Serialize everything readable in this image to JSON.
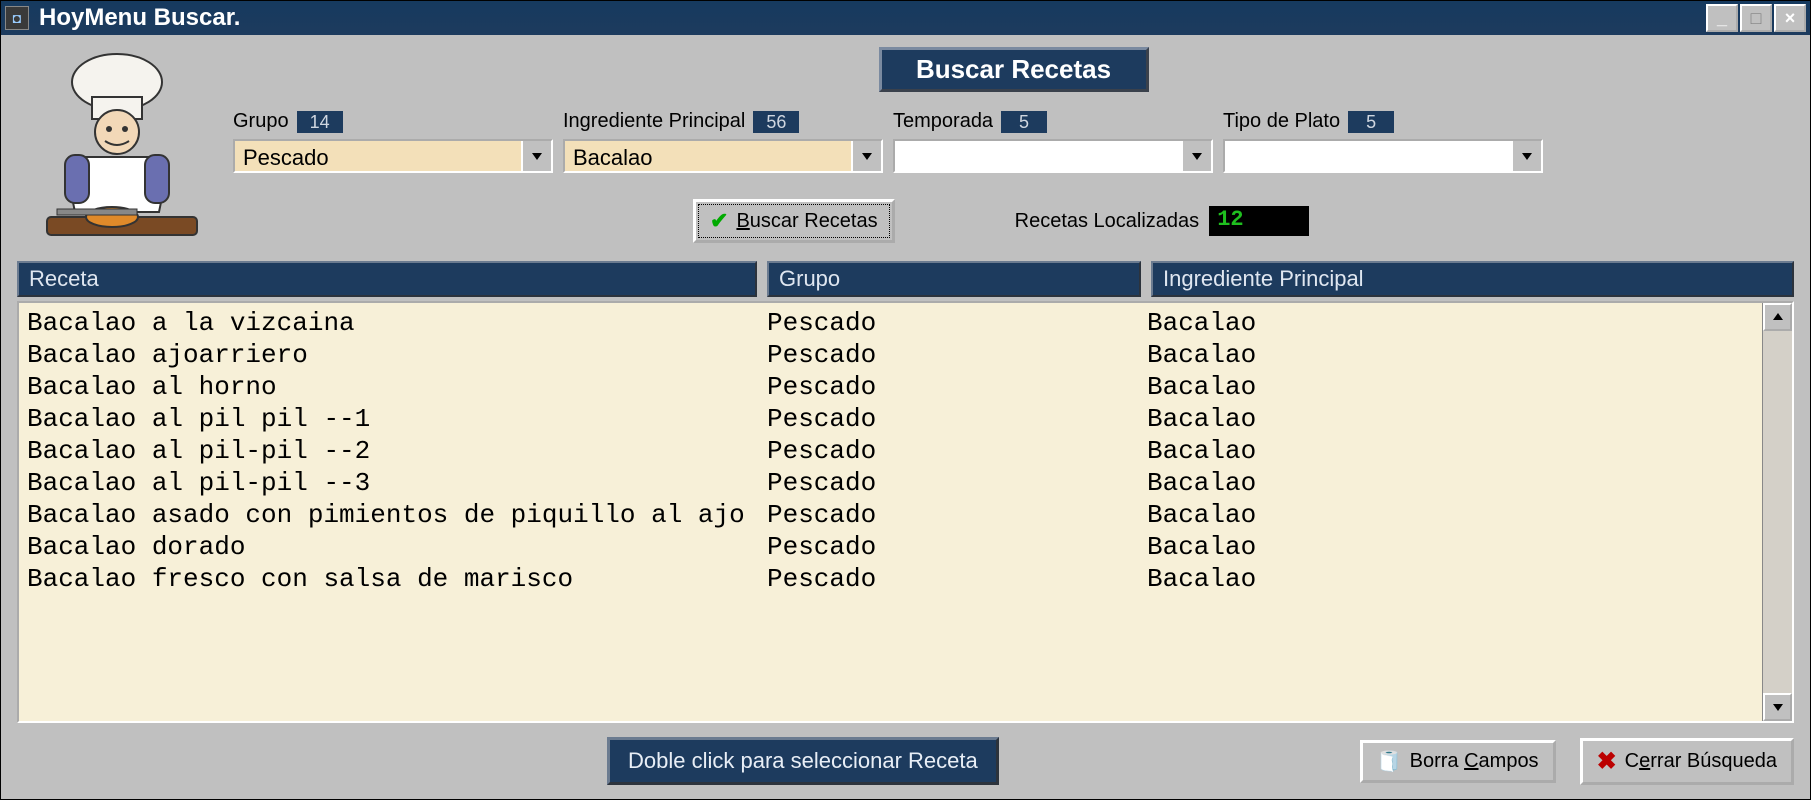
{
  "window": {
    "title": "HoyMenu  Buscar."
  },
  "banner": "Buscar Recetas",
  "filters": {
    "grupo": {
      "label": "Grupo",
      "count": "14",
      "value": "Pescado"
    },
    "ingrediente": {
      "label": "Ingrediente Principal",
      "count": "56",
      "value": "Bacalao"
    },
    "temporada": {
      "label": "Temporada",
      "count": "5",
      "value": ""
    },
    "tipoPlato": {
      "label": "Tipo de Plato",
      "count": "5",
      "value": ""
    }
  },
  "searchButton": "Buscar Recetas",
  "locatedLabel": "Recetas Localizadas",
  "locatedCount": "12",
  "columns": {
    "receta": "Receta",
    "grupo": "Grupo",
    "ingrediente": "Ingrediente Principal"
  },
  "rows": [
    {
      "receta": "Bacalao a la vizcaina",
      "grupo": "Pescado",
      "ingrediente": "Bacalao"
    },
    {
      "receta": "Bacalao ajoarriero",
      "grupo": "Pescado",
      "ingrediente": "Bacalao"
    },
    {
      "receta": "Bacalao al horno",
      "grupo": "Pescado",
      "ingrediente": "Bacalao"
    },
    {
      "receta": "Bacalao al pil pil --1",
      "grupo": "Pescado",
      "ingrediente": "Bacalao"
    },
    {
      "receta": "Bacalao al pil-pil --2",
      "grupo": "Pescado",
      "ingrediente": "Bacalao"
    },
    {
      "receta": "Bacalao al pil-pil --3",
      "grupo": "Pescado",
      "ingrediente": "Bacalao"
    },
    {
      "receta": "Bacalao asado con pimientos de piquillo al ajo",
      "grupo": "Pescado",
      "ingrediente": "Bacalao"
    },
    {
      "receta": "Bacalao dorado",
      "grupo": "Pescado",
      "ingrediente": "Bacalao"
    },
    {
      "receta": "Bacalao fresco con salsa de marisco",
      "grupo": "Pescado",
      "ingrediente": "Bacalao"
    }
  ],
  "hint": "Doble click para seleccionar Receta",
  "clearButton": {
    "pre": "Borra ",
    "u": "C",
    "post": "ampos"
  },
  "closeButton": {
    "pre": "C",
    "u": "e",
    "post": "rrar Búsqueda"
  }
}
